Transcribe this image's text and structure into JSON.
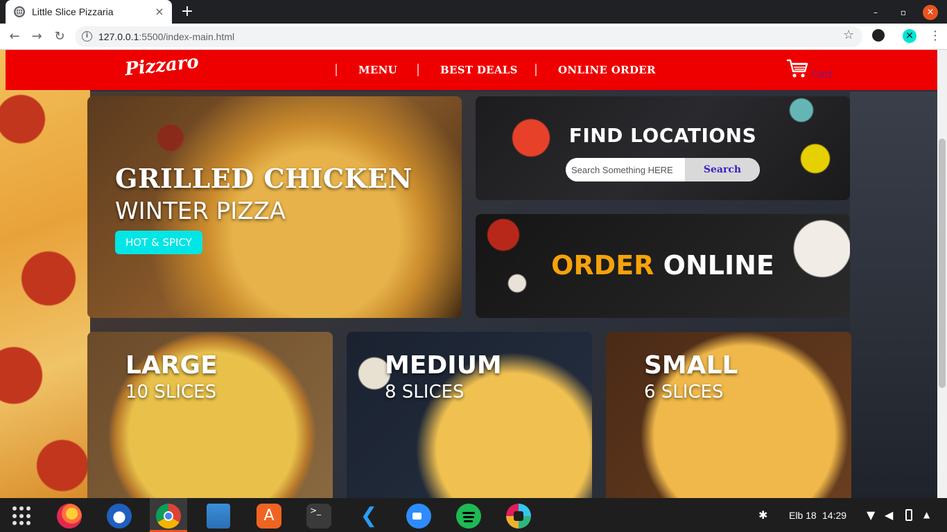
{
  "browser": {
    "tab_title": "Little Slice Pizzaria",
    "tab_close": "×",
    "new_tab": "+",
    "url_host": "127.0.0.1",
    "url_path": ":5500/index-main.html",
    "window_minimize": "–",
    "window_maximize": "▫",
    "window_close": "×"
  },
  "site": {
    "logo": "Pizzaro",
    "nav": [
      "MENU",
      "BEST DEALS",
      "ONLINE ORDER"
    ],
    "cart_label": "Cart"
  },
  "hero": {
    "title": "GRILLED CHICKEN",
    "subtitle": "WINTER PIZZA",
    "badge": "HOT & SPICY"
  },
  "find_locations": {
    "title": "FIND LOCATIONS",
    "search_placeholder": "Search Something HERE",
    "search_button": "Search"
  },
  "order_online": {
    "word1": "ORDER",
    "word2": "ONLINE",
    "accent_color": "#f6a20a"
  },
  "sizes": [
    {
      "name": "LARGE",
      "slices": "10 SLICES"
    },
    {
      "name": "MEDIUM",
      "slices": "8 SLICES"
    },
    {
      "name": "SMALL",
      "slices": "6 SLICES"
    }
  ],
  "taskbar": {
    "apps": [
      "firefox-icon",
      "thunderbird-icon",
      "chrome-icon",
      "files-icon",
      "software-center-icon",
      "terminal-icon",
      "vscode-icon",
      "zoom-icon",
      "spotify-icon",
      "slack-icon"
    ],
    "date": "Elb 18",
    "time": "14:29"
  },
  "colors": {
    "header_red": "#ee0000",
    "badge_cyan": "#00e5e5",
    "search_button_text": "#3d1fbf",
    "cart_text": "#6a1b9a"
  }
}
